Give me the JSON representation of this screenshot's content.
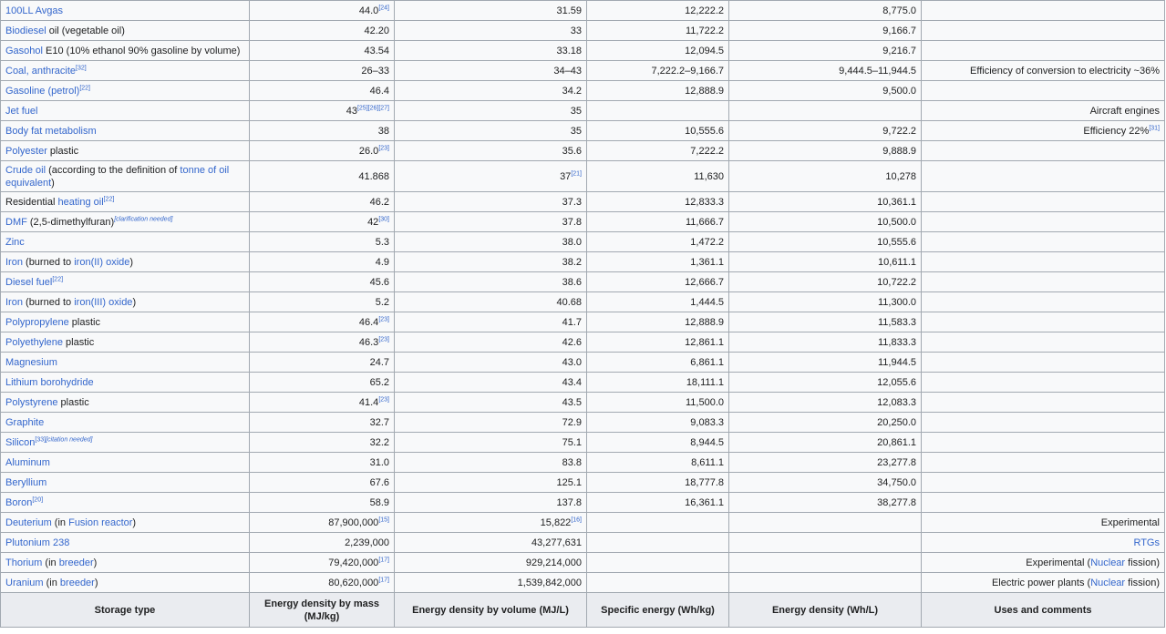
{
  "columns": [
    "Storage type",
    "Energy density by mass (MJ/kg)",
    "Energy density by volume (MJ/L)",
    "Specific energy (Wh/kg)",
    "Energy density (Wh/L)",
    "Uses and comments"
  ],
  "rows": [
    {
      "name": [
        {
          "t": "100LL Avgas",
          "l": 1
        }
      ],
      "mass": "44.0",
      "mass_ref": "[24]",
      "vol": "31.59",
      "vol_ref": "",
      "spec": "12,222.2",
      "dens": "8,775.0",
      "cmt": []
    },
    {
      "name": [
        {
          "t": "Biodiesel",
          "l": 1
        },
        {
          "t": " oil (vegetable oil)",
          "l": 0
        }
      ],
      "mass": "42.20",
      "mass_ref": "",
      "vol": "33",
      "vol_ref": "",
      "spec": "11,722.2",
      "dens": "9,166.7",
      "cmt": []
    },
    {
      "name": [
        {
          "t": "Gasohol",
          "l": 1
        },
        {
          "t": " E10 (10% ethanol 90% gasoline by volume)",
          "l": 0
        }
      ],
      "mass": "43.54",
      "mass_ref": "",
      "vol": "33.18",
      "vol_ref": "",
      "spec": "12,094.5",
      "dens": "9,216.7",
      "cmt": []
    },
    {
      "name": [
        {
          "t": "Coal, anthracite",
          "l": 1
        },
        {
          "t": "[32]",
          "s": 1
        }
      ],
      "mass": "26–33",
      "mass_ref": "",
      "vol": "34–43",
      "vol_ref": "",
      "spec": "7,222.2–9,166.7",
      "dens": "9,444.5–11,944.5",
      "cmt": [
        {
          "t": "Efficiency of conversion to electricity ~36%",
          "l": 0
        }
      ]
    },
    {
      "name": [
        {
          "t": "Gasoline (petrol)",
          "l": 1
        },
        {
          "t": "[22]",
          "s": 1
        }
      ],
      "mass": "46.4",
      "mass_ref": "",
      "vol": "34.2",
      "vol_ref": "",
      "spec": "12,888.9",
      "dens": "9,500.0",
      "cmt": []
    },
    {
      "name": [
        {
          "t": "Jet fuel",
          "l": 1
        }
      ],
      "mass": "43",
      "mass_ref": "[25][26][27]",
      "vol": "35",
      "vol_ref": "",
      "spec": "",
      "dens": "",
      "cmt": [
        {
          "t": "Aircraft engines",
          "l": 0
        }
      ]
    },
    {
      "name": [
        {
          "t": "Body fat metabolism",
          "l": 1
        }
      ],
      "mass": "38",
      "mass_ref": "",
      "vol": "35",
      "vol_ref": "",
      "spec": "10,555.6",
      "dens": "9,722.2",
      "cmt": [
        {
          "t": "Efficiency 22%",
          "l": 0
        },
        {
          "t": "[31]",
          "s": 1
        }
      ]
    },
    {
      "name": [
        {
          "t": "Polyester",
          "l": 1
        },
        {
          "t": " plastic",
          "l": 0
        }
      ],
      "mass": "26.0",
      "mass_ref": "[23]",
      "vol": "35.6",
      "vol_ref": "",
      "spec": "7,222.2",
      "dens": "9,888.9",
      "cmt": []
    },
    {
      "tall": true,
      "name": [
        {
          "t": "Crude oil",
          "l": 1
        },
        {
          "t": " (according to the definition of ",
          "l": 0
        },
        {
          "t": "tonne of oil equivalent",
          "l": 1
        },
        {
          "t": ")",
          "l": 0
        }
      ],
      "mass": "41.868",
      "mass_ref": "",
      "vol": "37",
      "vol_ref": "[21]",
      "spec": "11,630",
      "dens": "10,278",
      "cmt": []
    },
    {
      "name": [
        {
          "t": "Residential ",
          "l": 0
        },
        {
          "t": "heating oil",
          "l": 1
        },
        {
          "t": "[22]",
          "s": 1
        }
      ],
      "mass": "46.2",
      "mass_ref": "",
      "vol": "37.3",
      "vol_ref": "",
      "spec": "12,833.3",
      "dens": "10,361.1",
      "cmt": []
    },
    {
      "name": [
        {
          "t": "DMF",
          "l": 1
        },
        {
          "t": " (2,5-dimethylfuran)",
          "l": 0
        },
        {
          "t": "[clarification needed]",
          "s": 1,
          "i": 1
        }
      ],
      "mass": "42",
      "mass_ref": "[30]",
      "vol": "37.8",
      "vol_ref": "",
      "spec": "11,666.7",
      "dens": "10,500.0",
      "cmt": []
    },
    {
      "name": [
        {
          "t": "Zinc",
          "l": 1
        }
      ],
      "mass": "5.3",
      "mass_ref": "",
      "vol": "38.0",
      "vol_ref": "",
      "spec": "1,472.2",
      "dens": "10,555.6",
      "cmt": []
    },
    {
      "name": [
        {
          "t": "Iron",
          "l": 1
        },
        {
          "t": " (burned to ",
          "l": 0
        },
        {
          "t": "iron(II) oxide",
          "l": 1
        },
        {
          "t": ")",
          "l": 0
        }
      ],
      "mass": "4.9",
      "mass_ref": "",
      "vol": "38.2",
      "vol_ref": "",
      "spec": "1,361.1",
      "dens": "10,611.1",
      "cmt": []
    },
    {
      "name": [
        {
          "t": "Diesel fuel",
          "l": 1
        },
        {
          "t": "[22]",
          "s": 1
        }
      ],
      "mass": "45.6",
      "mass_ref": "",
      "vol": "38.6",
      "vol_ref": "",
      "spec": "12,666.7",
      "dens": "10,722.2",
      "cmt": []
    },
    {
      "name": [
        {
          "t": "Iron",
          "l": 1
        },
        {
          "t": " (burned to ",
          "l": 0
        },
        {
          "t": "iron(III) oxide",
          "l": 1
        },
        {
          "t": ")",
          "l": 0
        }
      ],
      "mass": "5.2",
      "mass_ref": "",
      "vol": "40.68",
      "vol_ref": "",
      "spec": "1,444.5",
      "dens": "11,300.0",
      "cmt": []
    },
    {
      "name": [
        {
          "t": "Polypropylene",
          "l": 1
        },
        {
          "t": " plastic",
          "l": 0
        }
      ],
      "mass": "46.4",
      "mass_ref": "[23]",
      "vol": "41.7",
      "vol_ref": "",
      "spec": "12,888.9",
      "dens": "11,583.3",
      "cmt": []
    },
    {
      "name": [
        {
          "t": "Polyethylene",
          "l": 1
        },
        {
          "t": " plastic",
          "l": 0
        }
      ],
      "mass": "46.3",
      "mass_ref": "[23]",
      "vol": "42.6",
      "vol_ref": "",
      "spec": "12,861.1",
      "dens": "11,833.3",
      "cmt": []
    },
    {
      "name": [
        {
          "t": "Magnesium",
          "l": 1
        }
      ],
      "mass": "24.7",
      "mass_ref": "",
      "vol": "43.0",
      "vol_ref": "",
      "spec": "6,861.1",
      "dens": "11,944.5",
      "cmt": []
    },
    {
      "name": [
        {
          "t": "Lithium borohydride",
          "l": 1
        }
      ],
      "mass": "65.2",
      "mass_ref": "",
      "vol": "43.4",
      "vol_ref": "",
      "spec": "18,111.1",
      "dens": "12,055.6",
      "cmt": []
    },
    {
      "name": [
        {
          "t": "Polystyrene",
          "l": 1
        },
        {
          "t": " plastic",
          "l": 0
        }
      ],
      "mass": "41.4",
      "mass_ref": "[23]",
      "vol": "43.5",
      "vol_ref": "",
      "spec": "11,500.0",
      "dens": "12,083.3",
      "cmt": []
    },
    {
      "name": [
        {
          "t": "Graphite",
          "l": 1
        }
      ],
      "mass": "32.7",
      "mass_ref": "",
      "vol": "72.9",
      "vol_ref": "",
      "spec": "9,083.3",
      "dens": "20,250.0",
      "cmt": []
    },
    {
      "name": [
        {
          "t": "Silicon",
          "l": 1
        },
        {
          "t": "[33]",
          "s": 1
        },
        {
          "t": "[citation needed]",
          "s": 1,
          "i": 1
        }
      ],
      "mass": "32.2",
      "mass_ref": "",
      "vol": "75.1",
      "vol_ref": "",
      "spec": "8,944.5",
      "dens": "20,861.1",
      "cmt": []
    },
    {
      "name": [
        {
          "t": "Aluminum",
          "l": 1
        }
      ],
      "mass": "31.0",
      "mass_ref": "",
      "vol": "83.8",
      "vol_ref": "",
      "spec": "8,611.1",
      "dens": "23,277.8",
      "cmt": []
    },
    {
      "name": [
        {
          "t": "Beryllium",
          "l": 1
        }
      ],
      "mass": "67.6",
      "mass_ref": "",
      "vol": "125.1",
      "vol_ref": "",
      "spec": "18,777.8",
      "dens": "34,750.0",
      "cmt": []
    },
    {
      "name": [
        {
          "t": "Boron",
          "l": 1
        },
        {
          "t": "[20]",
          "s": 1
        }
      ],
      "mass": "58.9",
      "mass_ref": "",
      "vol": "137.8",
      "vol_ref": "",
      "spec": "16,361.1",
      "dens": "38,277.8",
      "cmt": []
    },
    {
      "name": [
        {
          "t": "Deuterium",
          "l": 1
        },
        {
          "t": " (in ",
          "l": 0
        },
        {
          "t": "Fusion reactor",
          "l": 1
        },
        {
          "t": ")",
          "l": 0
        }
      ],
      "mass": "87,900,000",
      "mass_ref": "[15]",
      "vol": "15,822",
      "vol_ref": "[16]",
      "spec": "",
      "dens": "",
      "cmt": [
        {
          "t": "Experimental",
          "l": 0
        }
      ]
    },
    {
      "name": [
        {
          "t": "Plutonium 238",
          "l": 1
        }
      ],
      "mass": "2,239,000",
      "mass_ref": "",
      "vol": "43,277,631",
      "vol_ref": "",
      "spec": "",
      "dens": "",
      "cmt": [
        {
          "t": "RTGs",
          "l": 1
        }
      ]
    },
    {
      "name": [
        {
          "t": "Thorium",
          "l": 1
        },
        {
          "t": " (in ",
          "l": 0
        },
        {
          "t": "breeder",
          "l": 1
        },
        {
          "t": ")",
          "l": 0
        }
      ],
      "mass": "79,420,000",
      "mass_ref": "[17]",
      "vol": "929,214,000",
      "vol_ref": "",
      "spec": "",
      "dens": "",
      "cmt": [
        {
          "t": "Experimental (",
          "l": 0
        },
        {
          "t": "Nuclear",
          "l": 1
        },
        {
          "t": " fission)",
          "l": 0
        }
      ]
    },
    {
      "name": [
        {
          "t": "Uranium",
          "l": 1
        },
        {
          "t": " (in ",
          "l": 0
        },
        {
          "t": "breeder",
          "l": 1
        },
        {
          "t": ")",
          "l": 0
        }
      ],
      "mass": "80,620,000",
      "mass_ref": "[17]",
      "vol": "1,539,842,000",
      "vol_ref": "",
      "spec": "",
      "dens": "",
      "cmt": [
        {
          "t": "Electric power plants (",
          "l": 0
        },
        {
          "t": "Nuclear",
          "l": 1
        },
        {
          "t": " fission)",
          "l": 0
        }
      ]
    }
  ]
}
